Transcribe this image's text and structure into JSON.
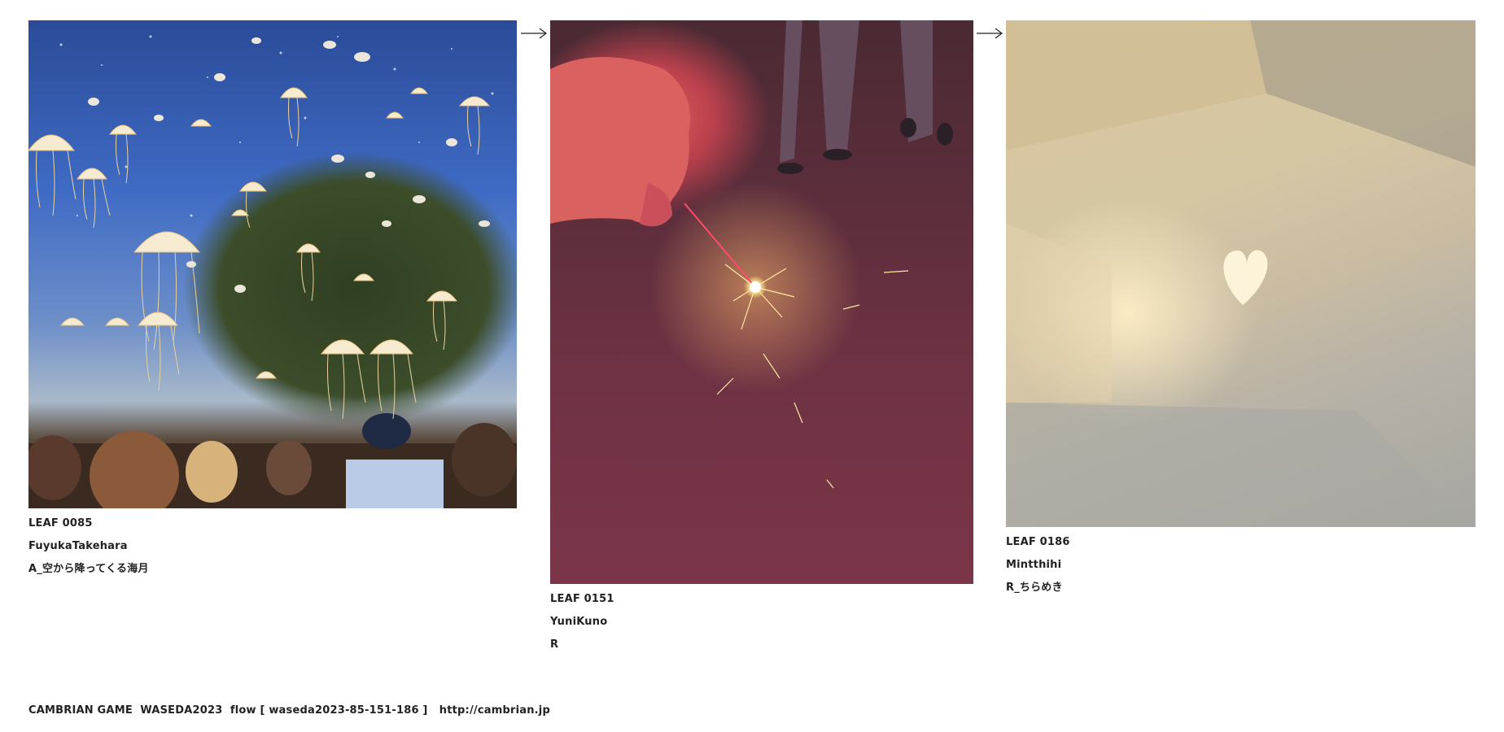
{
  "flow": {
    "leaves": [
      {
        "id": "LEAF 0085",
        "author": "FuyukaTakehara",
        "title": "A_空から降ってくる海月",
        "image": "jellyfish raining from sky over crowd and island"
      },
      {
        "id": "LEAF 0151",
        "author": "YuniKuno",
        "title": "R",
        "image": "hand holding a sparkler over red carpet"
      },
      {
        "id": "LEAF 0186",
        "author": "Mintthihi",
        "title": "R_ちらめき",
        "image": "heart-shaped light spot on a wall"
      }
    ],
    "arrows": [
      "arrow-right-icon",
      "arrow-right-icon"
    ]
  },
  "footer": {
    "credit": "CAMBRIAN GAME  WASEDA2023  flow [ waseda2023-85-151-186 ]   ",
    "url": "http://cambrian.jp"
  },
  "colors": {
    "text": "#222222",
    "background": "#ffffff"
  }
}
